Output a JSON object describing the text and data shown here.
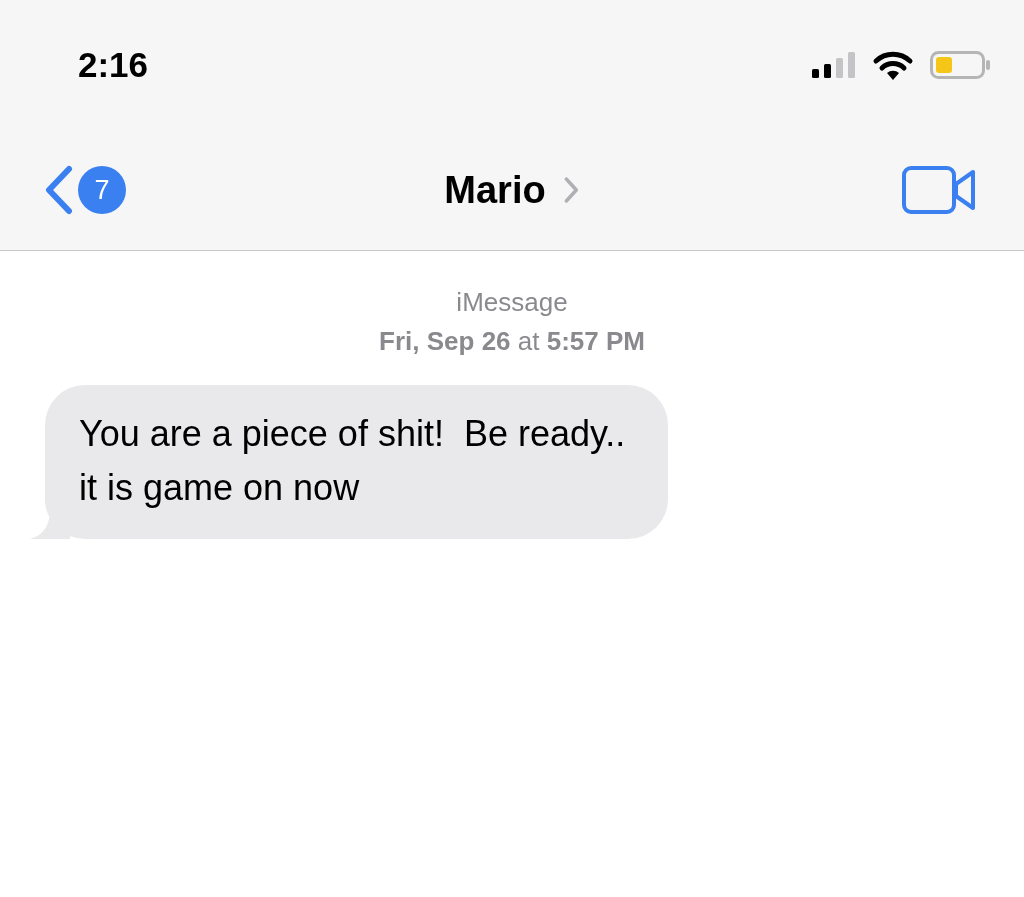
{
  "status_bar": {
    "time": "2:16"
  },
  "nav": {
    "back_badge": "7",
    "title": "Mario"
  },
  "conversation": {
    "service": "iMessage",
    "timestamp": "**Fri, Sep 26** at **5:57 PM**",
    "messages": [
      {
        "kind": "received",
        "text": "You are a piece of shit!  Be ready.. it is game on now"
      }
    ]
  }
}
